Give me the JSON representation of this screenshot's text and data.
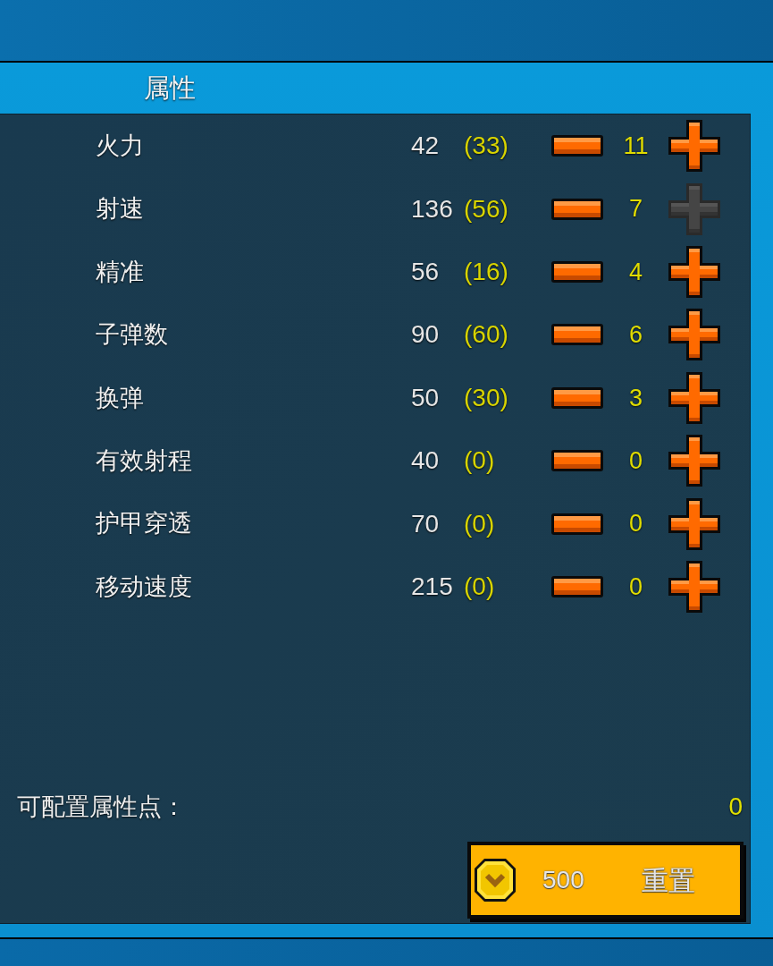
{
  "header": {
    "title": "属性"
  },
  "attributes": [
    {
      "name": "火力",
      "value": "42",
      "bonus": "(33)",
      "points": "11",
      "plus_disabled": false
    },
    {
      "name": "射速",
      "value": "136",
      "bonus": "(56)",
      "points": "7",
      "plus_disabled": true
    },
    {
      "name": "精准",
      "value": "56",
      "bonus": "(16)",
      "points": "4",
      "plus_disabled": false
    },
    {
      "name": "子弹数",
      "value": "90",
      "bonus": "(60)",
      "points": "6",
      "plus_disabled": false
    },
    {
      "name": "换弹",
      "value": "50",
      "bonus": "(30)",
      "points": "3",
      "plus_disabled": false
    },
    {
      "name": "有效射程",
      "value": "40",
      "bonus": "(0)",
      "points": "0",
      "plus_disabled": false
    },
    {
      "name": "护甲穿透",
      "value": "70",
      "bonus": "(0)",
      "points": "0",
      "plus_disabled": false
    },
    {
      "name": "移动速度",
      "value": "215",
      "bonus": "(0)",
      "points": "0",
      "plus_disabled": false
    }
  ],
  "available_points": {
    "label": "可配置属性点：",
    "value": "0"
  },
  "reset_button": {
    "cost": "500",
    "label": "重置"
  }
}
